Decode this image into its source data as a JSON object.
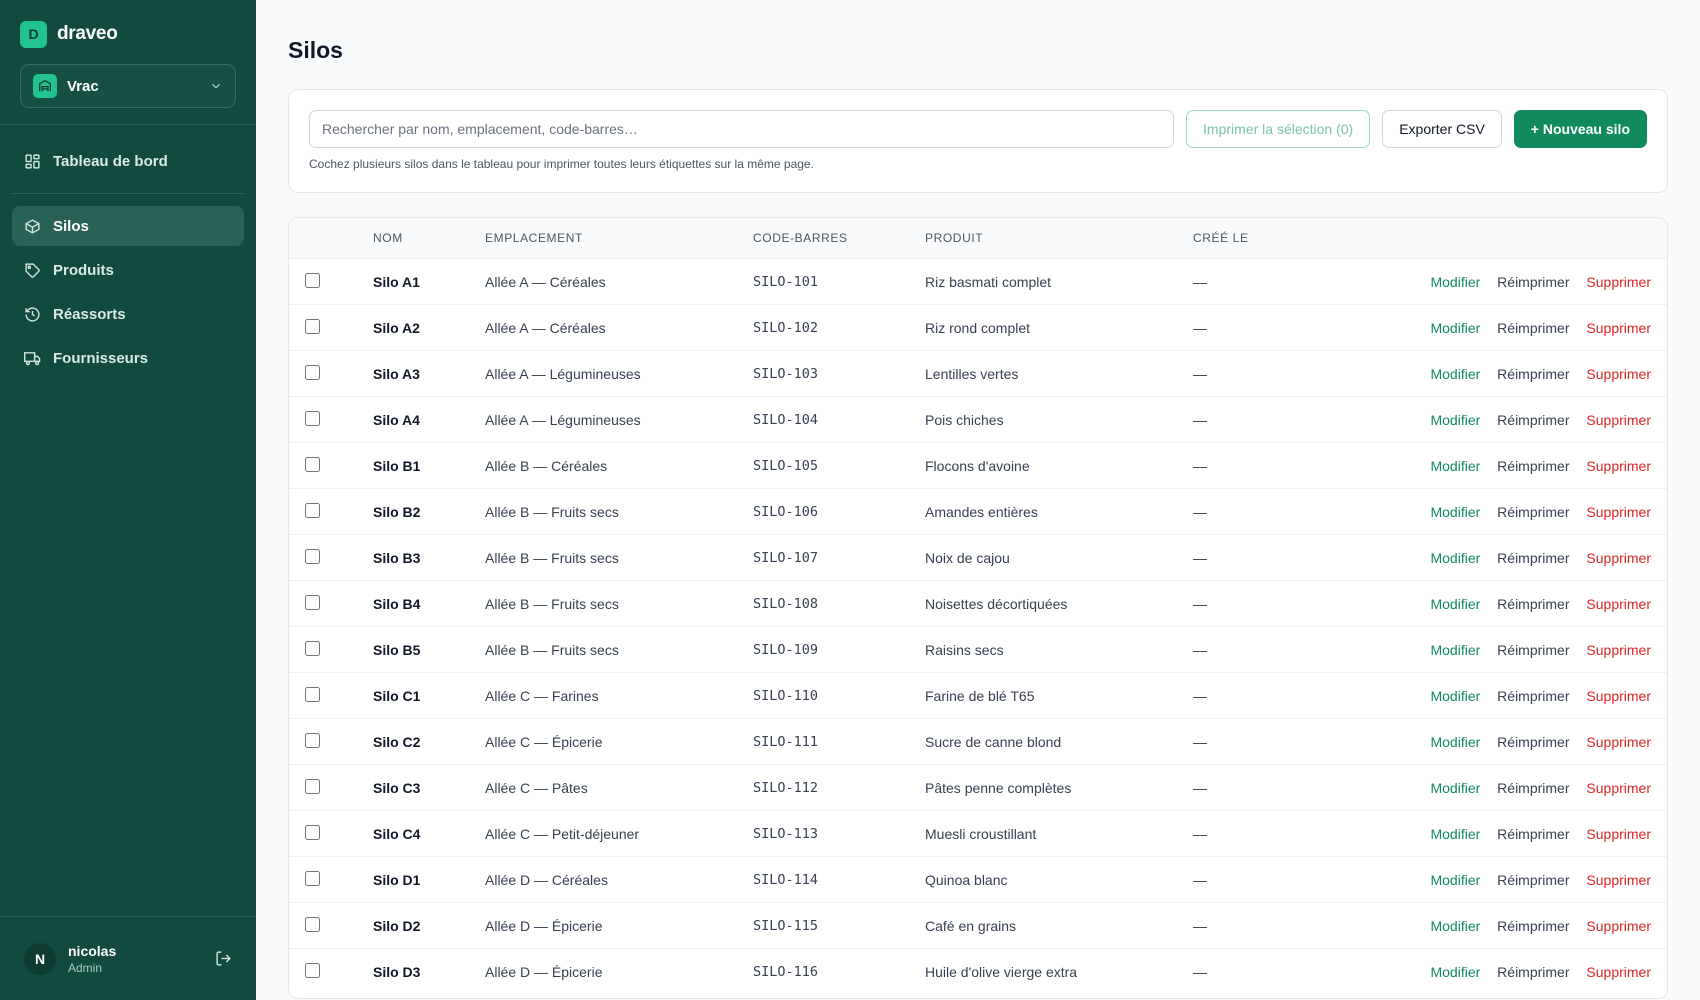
{
  "brand": {
    "logo_letter": "D",
    "name": "draveo"
  },
  "workspace": {
    "name": "Vrac"
  },
  "nav": {
    "items": [
      {
        "id": "dashboard",
        "label": "Tableau de bord",
        "icon": "grid-icon"
      },
      {
        "id": "silos",
        "label": "Silos",
        "icon": "box-icon",
        "active": true
      },
      {
        "id": "produits",
        "label": "Produits",
        "icon": "tag-icon"
      },
      {
        "id": "reassorts",
        "label": "Réassorts",
        "icon": "history-icon"
      },
      {
        "id": "fournisseurs",
        "label": "Fournisseurs",
        "icon": "truck-icon"
      }
    ]
  },
  "user": {
    "initial": "N",
    "name": "nicolas",
    "role": "Admin"
  },
  "page": {
    "title": "Silos"
  },
  "toolbar": {
    "search_placeholder": "Rechercher par nom, emplacement, code-barres…",
    "print_label": "Imprimer la sélection (0)",
    "export_label": "Exporter CSV",
    "new_label": "+ Nouveau silo",
    "hint": "Cochez plusieurs silos dans le tableau pour imprimer toutes leurs étiquettes sur la même page."
  },
  "table": {
    "columns": [
      "NOM",
      "EMPLACEMENT",
      "CODE-BARRES",
      "PRODUIT",
      "CRÉÉ LE"
    ],
    "actions": {
      "edit": "Modifier",
      "reprint": "Réimprimer",
      "delete": "Supprimer"
    },
    "rows": [
      {
        "nom": "Silo A1",
        "emplacement": "Allée A — Céréales",
        "code": "SILO-101",
        "produit": "Riz basmati complet",
        "cree": "—"
      },
      {
        "nom": "Silo A2",
        "emplacement": "Allée A — Céréales",
        "code": "SILO-102",
        "produit": "Riz rond complet",
        "cree": "—"
      },
      {
        "nom": "Silo A3",
        "emplacement": "Allée A — Légumineuses",
        "code": "SILO-103",
        "produit": "Lentilles vertes",
        "cree": "—"
      },
      {
        "nom": "Silo A4",
        "emplacement": "Allée A — Légumineuses",
        "code": "SILO-104",
        "produit": "Pois chiches",
        "cree": "—"
      },
      {
        "nom": "Silo B1",
        "emplacement": "Allée B — Céréales",
        "code": "SILO-105",
        "produit": "Flocons d'avoine",
        "cree": "—"
      },
      {
        "nom": "Silo B2",
        "emplacement": "Allée B — Fruits secs",
        "code": "SILO-106",
        "produit": "Amandes entières",
        "cree": "—"
      },
      {
        "nom": "Silo B3",
        "emplacement": "Allée B — Fruits secs",
        "code": "SILO-107",
        "produit": "Noix de cajou",
        "cree": "—"
      },
      {
        "nom": "Silo B4",
        "emplacement": "Allée B — Fruits secs",
        "code": "SILO-108",
        "produit": "Noisettes décortiquées",
        "cree": "—"
      },
      {
        "nom": "Silo B5",
        "emplacement": "Allée B — Fruits secs",
        "code": "SILO-109",
        "produit": "Raisins secs",
        "cree": "—"
      },
      {
        "nom": "Silo C1",
        "emplacement": "Allée C — Farines",
        "code": "SILO-110",
        "produit": "Farine de blé T65",
        "cree": "—"
      },
      {
        "nom": "Silo C2",
        "emplacement": "Allée C — Épicerie",
        "code": "SILO-111",
        "produit": "Sucre de canne blond",
        "cree": "—"
      },
      {
        "nom": "Silo C3",
        "emplacement": "Allée C — Pâtes",
        "code": "SILO-112",
        "produit": "Pâtes penne complètes",
        "cree": "—"
      },
      {
        "nom": "Silo C4",
        "emplacement": "Allée C — Petit-déjeuner",
        "code": "SILO-113",
        "produit": "Muesli croustillant",
        "cree": "—"
      },
      {
        "nom": "Silo D1",
        "emplacement": "Allée D — Céréales",
        "code": "SILO-114",
        "produit": "Quinoa blanc",
        "cree": "—"
      },
      {
        "nom": "Silo D2",
        "emplacement": "Allée D — Épicerie",
        "code": "SILO-115",
        "produit": "Café en grains",
        "cree": "—"
      },
      {
        "nom": "Silo D3",
        "emplacement": "Allée D — Épicerie",
        "code": "SILO-116",
        "produit": "Huile d'olive vierge extra",
        "cree": "—"
      }
    ]
  },
  "colors": {
    "sidebar": "#124a3f",
    "accent": "#118a5e",
    "danger": "#dc2626"
  }
}
